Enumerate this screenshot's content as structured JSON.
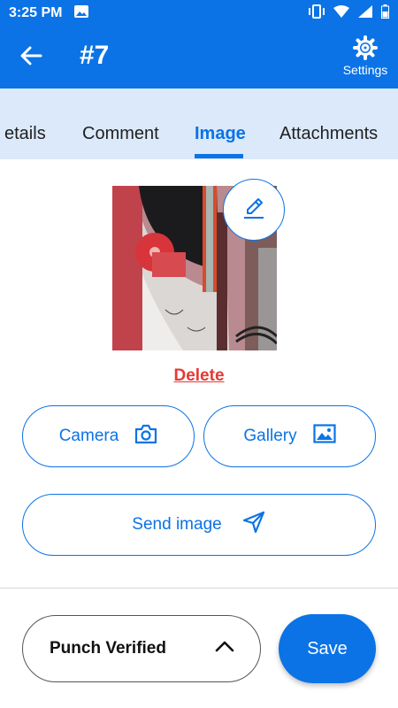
{
  "status_bar": {
    "time": "3:25 PM"
  },
  "appbar": {
    "title": "#7",
    "settings_label": "Settings"
  },
  "tabs": [
    {
      "label": "etails"
    },
    {
      "label": "Comment"
    },
    {
      "label": "Image",
      "active": true
    },
    {
      "label": "Attachments"
    }
  ],
  "image": {
    "delete_label": "Delete"
  },
  "buttons": {
    "camera": "Camera",
    "gallery": "Gallery",
    "send_image": "Send image"
  },
  "footer": {
    "status_value": "Punch Verified",
    "save": "Save"
  },
  "colors": {
    "primary": "#0b73e6",
    "tab_background": "#dbe9fb",
    "delete": "#e53935"
  },
  "icons": [
    "image-icon",
    "vibrate-icon",
    "wifi-icon",
    "signal-icon",
    "battery-icon",
    "back-arrow-icon",
    "gear-icon",
    "pencil-icon",
    "camera-icon",
    "gallery-icon",
    "send-icon",
    "chevron-up-icon"
  ]
}
